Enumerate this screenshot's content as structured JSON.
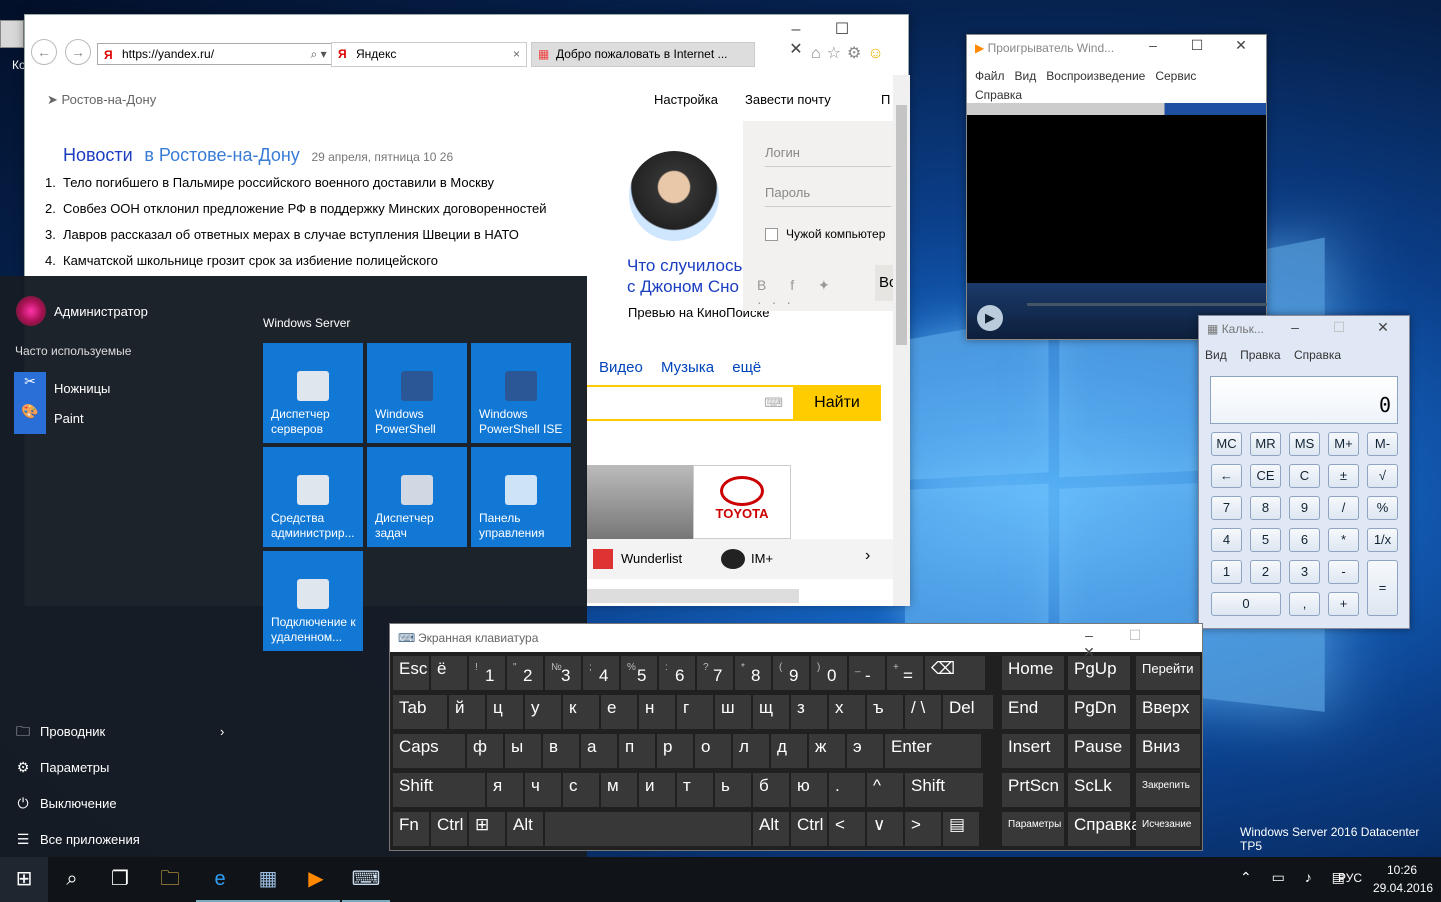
{
  "desktop": {
    "icon_label": "Ко",
    "watermark": "Windows Server 2016 Datacenter TP5"
  },
  "ie": {
    "url": "https://yandex.ru/",
    "tabs": [
      {
        "label": "Яндекс"
      },
      {
        "label": "Добро пожаловать в Internet ..."
      }
    ],
    "location": "Ростов-на-Дону",
    "top_links": [
      "Настройка",
      "Завести почту",
      "П"
    ],
    "news": {
      "title": "Новости",
      "region": "в Ростове-на-Дону",
      "date": "29 апреля, пятница 10 26",
      "items": [
        "Тело погибшего в Пальмире российского военного доставили в Москву",
        "Совбез ООН отклонил предложение РФ в поддержку Минских договоренностей",
        "Лавров рассказал об ответных мерах в случае вступления Швеции в НАТО",
        "Камчатской школьнице грозит срок за избиение полицейского"
      ]
    },
    "login": {
      "login_placeholder": "Логин",
      "password_placeholder": "Пароль",
      "foreign_pc": "Чужой компьютер",
      "btn": "Во"
    },
    "promo": {
      "title_line1": "Что случилось",
      "title_line2": "с Джоном Снo",
      "subtitle": "Превью на КиноПоиске"
    },
    "services": [
      "Видео",
      "Музыка",
      "ещё"
    ],
    "search_btn": "Найти",
    "ad_brand": "TOYOTA",
    "apps": [
      "Wunderlist",
      "IM+"
    ]
  },
  "start": {
    "user": "Администратор",
    "frequent_title": "Часто используемые",
    "frequent": [
      "Ножницы",
      "Paint"
    ],
    "group_title": "Windows Server",
    "tiles": [
      "Диспетчер серверов",
      "Windows PowerShell",
      "Windows PowerShell ISE",
      "Средства администрир...",
      "Диспетчер задач",
      "Панель управления",
      "Подключение к удаленном..."
    ],
    "bottom": [
      "Проводник",
      "Параметры",
      "Выключение",
      "Все приложения"
    ]
  },
  "wmp": {
    "title": "Проигрыватель Wind...",
    "menu": [
      "Файл",
      "Вид",
      "Воспроизведение",
      "Сервис",
      "Справка"
    ]
  },
  "calc": {
    "title": "Кальк...",
    "menu": [
      "Вид",
      "Правка",
      "Справка"
    ],
    "display": "0",
    "rows": [
      [
        "MC",
        "MR",
        "MS",
        "M+",
        "M-"
      ],
      [
        "←",
        "CE",
        "C",
        "±",
        "√"
      ],
      [
        "7",
        "8",
        "9",
        "/",
        "%"
      ],
      [
        "4",
        "5",
        "6",
        "*",
        "1/x"
      ],
      [
        "1",
        "2",
        "3",
        "-"
      ],
      [
        "0",
        ",",
        "+"
      ]
    ],
    "equals": "="
  },
  "osk": {
    "title": "Экранная клавиатура",
    "row1": [
      [
        "",
        "Esc"
      ],
      [
        "",
        "ё"
      ],
      [
        "!",
        "1"
      ],
      [
        "\"",
        "2"
      ],
      [
        "№",
        "3"
      ],
      [
        ";",
        "4"
      ],
      [
        "%",
        "5"
      ],
      [
        ":",
        "6"
      ],
      [
        "?",
        "7"
      ],
      [
        "*",
        "8"
      ],
      [
        "(",
        "9"
      ],
      [
        ")",
        "0"
      ],
      [
        "_",
        "-"
      ],
      [
        "+",
        "="
      ],
      [
        "",
        "⌫"
      ]
    ],
    "row2": [
      "Tab",
      "й",
      "ц",
      "у",
      "к",
      "е",
      "н",
      "г",
      "ш",
      "щ",
      "з",
      "х",
      "ъ",
      "/ \\",
      "Del"
    ],
    "row3": [
      "Caps",
      "ф",
      "ы",
      "в",
      "а",
      "п",
      "р",
      "о",
      "л",
      "д",
      "ж",
      "э",
      "Enter"
    ],
    "row4": [
      "Shift",
      "я",
      "ч",
      "с",
      "м",
      "и",
      "т",
      "ь",
      "б",
      "ю",
      ".",
      "^",
      "Shift"
    ],
    "row5": [
      "Fn",
      "Ctrl",
      "⊞",
      "Alt",
      "",
      "Alt",
      "Ctrl",
      "<",
      "∨",
      ">",
      "▤"
    ],
    "nav": [
      "Home",
      "PgUp",
      "Перейти",
      "End",
      "PgDn",
      "Вверх",
      "Insert",
      "Pause",
      "Вниз",
      "PrtScn",
      "ScLk",
      "Закрепить",
      "Параметры",
      "Справка",
      "Исчезание"
    ]
  },
  "taskbar": {
    "lang": "РУС",
    "time": "10:26",
    "date": "29.04.2016"
  }
}
